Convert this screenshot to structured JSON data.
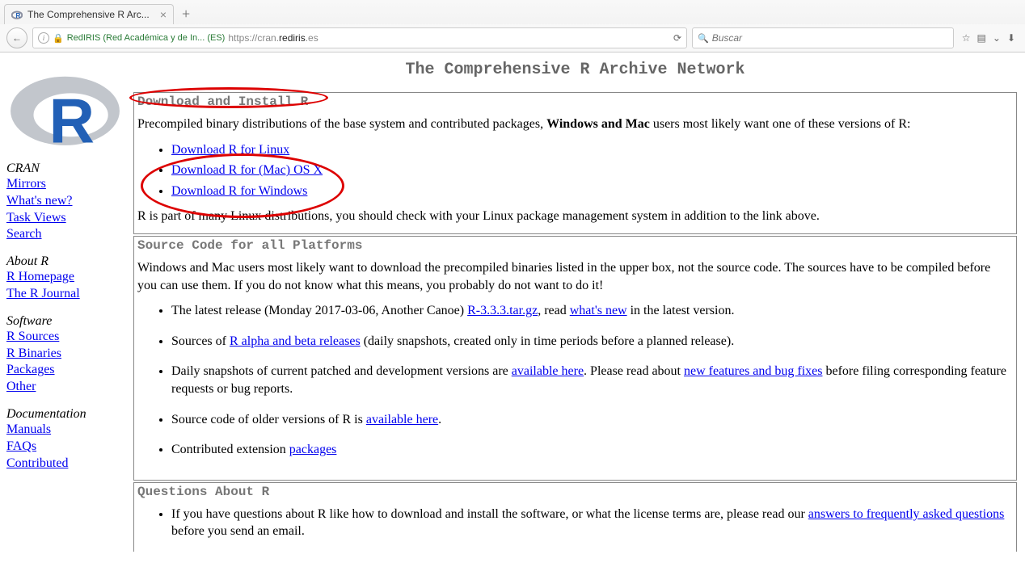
{
  "browser": {
    "tab": {
      "title": "The Comprehensive R Arc..."
    },
    "identity": "RedIRIS (Red Académica y de In...  (ES)",
    "url_scheme": "https://cran.",
    "url_host": "rediris",
    "url_tld": ".es",
    "search_placeholder": "Buscar"
  },
  "sidebar": {
    "cranHeading": "CRAN",
    "cran": [
      "Mirrors",
      "What's new?",
      "Task Views",
      "Search"
    ],
    "aboutHeading": "About R",
    "about": [
      "R Homepage",
      "The R Journal"
    ],
    "softwareHeading": "Software",
    "software": [
      "R Sources",
      "R Binaries",
      "Packages",
      "Other"
    ],
    "docHeading": "Documentation",
    "doc": [
      "Manuals",
      "FAQs",
      "Contributed"
    ]
  },
  "main": {
    "title": "The Comprehensive R Archive Network",
    "box1": {
      "heading": "Download and Install R",
      "intro_a": "Precompiled binary distributions of the base system and contributed packages, ",
      "intro_b": "Windows and Mac",
      "intro_c": " users most likely want one of these versions of R:",
      "links": [
        "Download R for Linux",
        "Download R for (Mac) OS X",
        "Download R for Windows"
      ],
      "outro": "R is part of many Linux distributions, you should check with your Linux package management system in addition to the link above."
    },
    "box2": {
      "heading": "Source Code for all Platforms",
      "intro": "Windows and Mac users most likely want to download the precompiled binaries listed in the upper box, not the source code. The sources have to be compiled before you can use them. If you do not know what this means, you probably do not want to do it!",
      "li1_a": "The latest release (Monday 2017-03-06, Another Canoe) ",
      "li1_link1": "R-3.3.3.tar.gz",
      "li1_b": ", read ",
      "li1_link2": "what's new",
      "li1_c": " in the latest version.",
      "li2_a": "Sources of ",
      "li2_link": "R alpha and beta releases",
      "li2_b": " (daily snapshots, created only in time periods before a planned release).",
      "li3_a": "Daily snapshots of current patched and development versions are ",
      "li3_link1": "available here",
      "li3_b": ". Please read about ",
      "li3_link2": "new features and bug fixes",
      "li3_c": " before filing corresponding feature requests or bug reports.",
      "li4_a": "Source code of older versions of R is ",
      "li4_link": "available here",
      "li4_b": ".",
      "li5_a": "Contributed extension ",
      "li5_link": "packages"
    },
    "box3": {
      "heading": "Questions About R",
      "li_a": "If you have questions about R like how to download and install the software, or what the license terms are, please read our ",
      "li_link": "answers to frequently asked questions",
      "li_b": " before you send an email."
    }
  }
}
